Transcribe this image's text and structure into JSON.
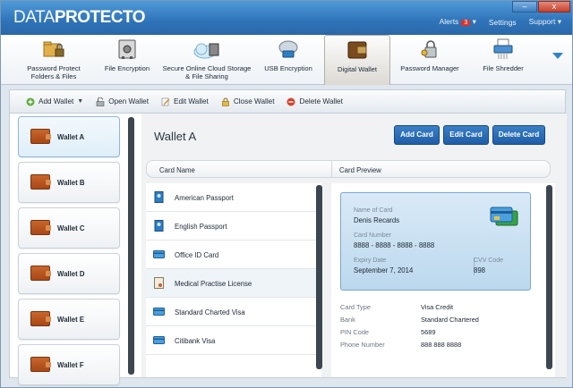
{
  "app": {
    "logo_part1": "DATA",
    "logo_part2": "PROTECTO",
    "alerts_label": "Alerts",
    "alerts_count": "3",
    "settings_label": "Settings",
    "support_label": "Support"
  },
  "window_buttons": {
    "minimize": "–",
    "close": "x"
  },
  "ribbon": {
    "tabs": [
      {
        "label": "Password Protect Folders & Files",
        "icon": "folder-lock-icon"
      },
      {
        "label": "File Encryption",
        "icon": "safe-icon"
      },
      {
        "label": "Secure Online Cloud Storage & File Sharing",
        "icon": "cloud-lock-icon"
      },
      {
        "label": "USB Encryption",
        "icon": "usb-drive-icon"
      },
      {
        "label": "Digital Wallet",
        "icon": "wallet-icon",
        "active": true
      },
      {
        "label": "Password Manager",
        "icon": "key-lock-icon"
      },
      {
        "label": "File Shredder",
        "icon": "shredder-icon"
      }
    ]
  },
  "toolbar": {
    "add_wallet": "Add Wallet",
    "open_wallet": "Open Wallet",
    "edit_wallet": "Edit Wallet",
    "close_wallet": "Close Wallet",
    "delete_wallet": "Delete Wallet"
  },
  "wallets": [
    "Wallet A",
    "Wallet B",
    "Wallet C",
    "Wallet D",
    "Wallet E",
    "Wallet F"
  ],
  "main": {
    "title": "Wallet A",
    "add_card": "Add Card",
    "edit_card": "Edit Card",
    "delete_card": "Delete Card",
    "col_card_name": "Card Name",
    "col_card_preview": "Card Preview"
  },
  "cards": [
    {
      "name": "American Passport",
      "icon": "passport-icon"
    },
    {
      "name": "English Passport",
      "icon": "passport-icon"
    },
    {
      "name": "Office ID Card",
      "icon": "credit-card-icon"
    },
    {
      "name": "Medical Practise License",
      "icon": "certificate-icon"
    },
    {
      "name": "Standard Charted Visa",
      "icon": "credit-card-icon"
    },
    {
      "name": "Citibank Visa",
      "icon": "credit-card-icon"
    }
  ],
  "preview": {
    "name_label": "Name of Card",
    "name_value": "Denis Recards",
    "number_label": "Card Number",
    "number_value": "8888 - 8888 - 8888 - 8888",
    "expiry_label": "Expiry Date",
    "expiry_value": "September 7, 2014",
    "cvv_label": "CVV Code",
    "cvv_value": "898",
    "type_label": "Card Type",
    "type_value": "Visa Credit",
    "bank_label": "Bank",
    "bank_value": "Standard Chartered",
    "pin_label": "PIN Code",
    "pin_value": "5689",
    "phone_label": "Phone Number",
    "phone_value": "888 888 8888"
  },
  "colors": {
    "accent": "#2f73b8",
    "button": "#1f5ea6",
    "wallet": "#b9531f"
  }
}
